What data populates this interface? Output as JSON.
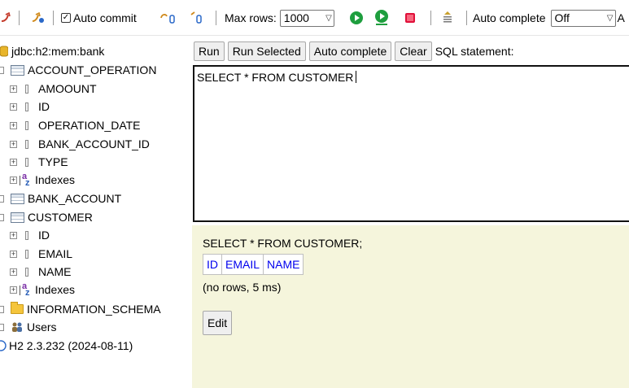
{
  "toolbar": {
    "auto_commit_label": "Auto commit",
    "auto_commit_checked": true,
    "max_rows_label": "Max rows:",
    "max_rows_value": "1000",
    "auto_complete_label": "Auto complete",
    "auto_complete_value": "Off",
    "truncated_label": "A",
    "icons": [
      "refresh-icon",
      "auto-commit-icon",
      "rollback-icon",
      "commit-icon",
      "run-icon",
      "run-selected-icon",
      "stop-icon",
      "history-icon"
    ]
  },
  "tree": {
    "database": "jdbc:h2:mem:bank",
    "tables": [
      {
        "name": "ACCOUNT_OPERATION",
        "columns": [
          "AMOOUNT",
          "ID",
          "OPERATION_DATE",
          "BANK_ACCOUNT_ID",
          "TYPE"
        ],
        "indexes_label": "Indexes"
      },
      {
        "name": "BANK_ACCOUNT"
      },
      {
        "name": "CUSTOMER",
        "columns": [
          "ID",
          "EMAIL",
          "NAME"
        ],
        "indexes_label": "Indexes"
      }
    ],
    "schema": "INFORMATION_SCHEMA",
    "users": "Users",
    "version": "H2 2.3.232 (2024-08-11)"
  },
  "sql_panel": {
    "buttons": [
      "Run",
      "Run Selected",
      "Auto complete",
      "Clear"
    ],
    "statement_label": "SQL statement:",
    "editor_text": "SELECT * FROM CUSTOMER"
  },
  "results": {
    "query": "SELECT * FROM CUSTOMER;",
    "columns": [
      "ID",
      "EMAIL",
      "NAME"
    ],
    "info": "(no rows, 5 ms)",
    "edit_label": "Edit"
  },
  "colors": {
    "results_bg": "#f5f5dc",
    "header_link": "#0000ee",
    "run_green": "#1e9e3e",
    "stop_red": "#e0103a"
  }
}
